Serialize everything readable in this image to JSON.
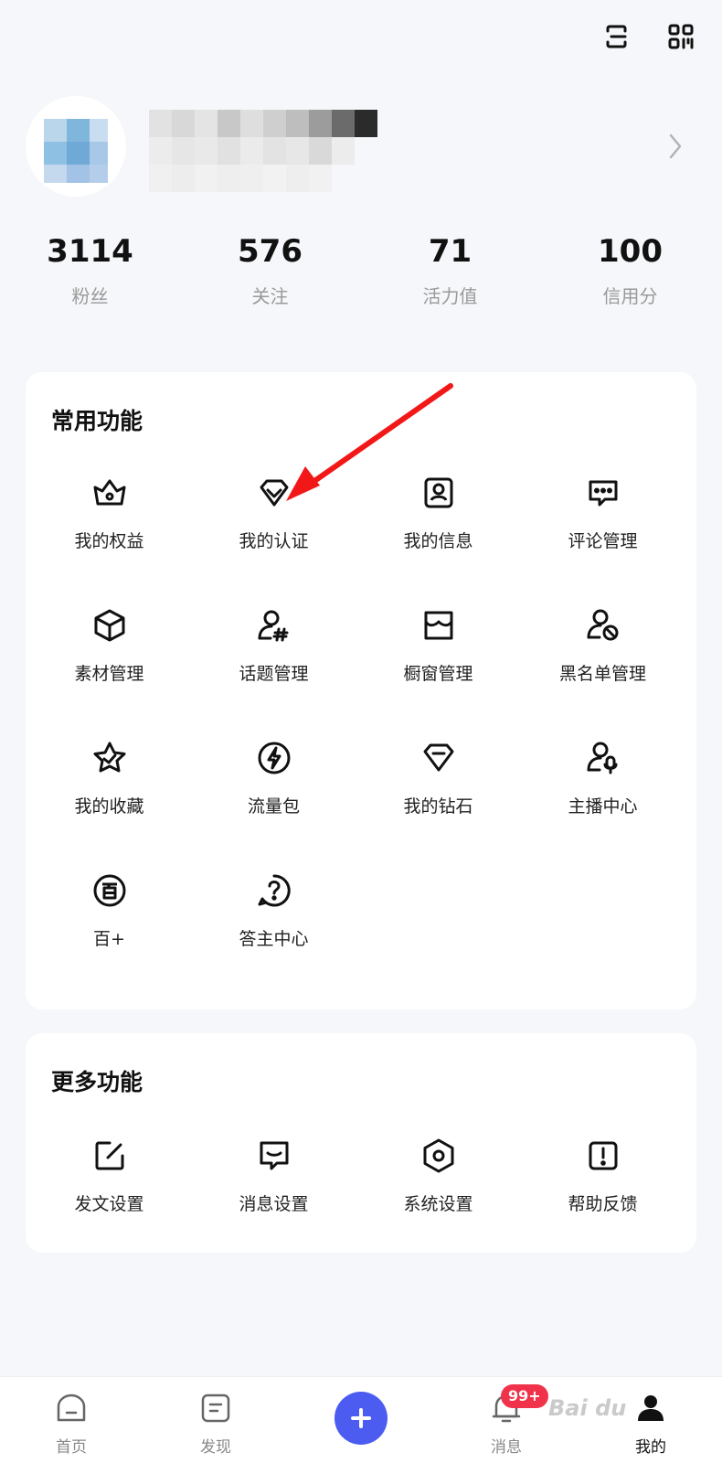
{
  "stats": [
    {
      "value": "3114",
      "label": "粉丝"
    },
    {
      "value": "576",
      "label": "关注"
    },
    {
      "value": "71",
      "label": "活力值"
    },
    {
      "value": "100",
      "label": "信用分"
    }
  ],
  "common": {
    "title": "常用功能",
    "items": [
      {
        "label": "我的权益",
        "icon": "crown-icon"
      },
      {
        "label": "我的认证",
        "icon": "verify-badge-icon"
      },
      {
        "label": "我的信息",
        "icon": "profile-card-icon"
      },
      {
        "label": "评论管理",
        "icon": "comment-icon"
      },
      {
        "label": "素材管理",
        "icon": "cube-icon"
      },
      {
        "label": "话题管理",
        "icon": "topic-user-icon"
      },
      {
        "label": "橱窗管理",
        "icon": "storefront-icon"
      },
      {
        "label": "黑名单管理",
        "icon": "block-user-icon"
      },
      {
        "label": "我的收藏",
        "icon": "star-icon"
      },
      {
        "label": "流量包",
        "icon": "lightning-icon"
      },
      {
        "label": "我的钻石",
        "icon": "diamond-icon"
      },
      {
        "label": "主播中心",
        "icon": "streamer-icon"
      },
      {
        "label": "百+",
        "icon": "bai-plus-icon"
      },
      {
        "label": "答主中心",
        "icon": "question-bubble-icon"
      }
    ]
  },
  "more": {
    "title": "更多功能",
    "items": [
      {
        "label": "发文设置",
        "icon": "edit-square-icon"
      },
      {
        "label": "消息设置",
        "icon": "message-settings-icon"
      },
      {
        "label": "系统设置",
        "icon": "hexagon-settings-icon"
      },
      {
        "label": "帮助反馈",
        "icon": "exclamation-icon"
      }
    ]
  },
  "nav": {
    "items": [
      {
        "label": "首页",
        "icon": "home-icon"
      },
      {
        "label": "发现",
        "icon": "discover-icon"
      },
      {
        "label": "",
        "icon": "plus-icon"
      },
      {
        "label": "消息",
        "icon": "bell-icon"
      },
      {
        "label": "我的",
        "icon": "user-icon"
      }
    ],
    "badge": "99+",
    "active": "我的"
  },
  "watermark": "Bai du",
  "colors": {
    "accent": "#4c5cf0",
    "badge": "#f0334a",
    "annotation_arrow": "#f21818"
  }
}
